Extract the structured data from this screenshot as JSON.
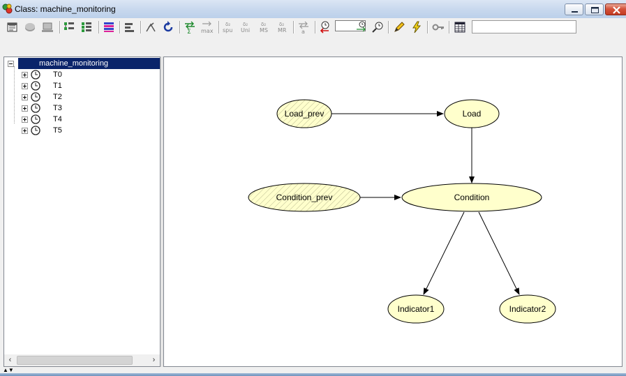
{
  "window": {
    "title": "Class: machine_monitoring"
  },
  "toolbar": {
    "search_value": "",
    "time_value": ""
  },
  "tree": {
    "root": "machine_monitoring",
    "children": [
      "T0",
      "T1",
      "T2",
      "T3",
      "T4",
      "T5"
    ]
  },
  "graph": {
    "nodes": {
      "load_prev": "Load_prev",
      "load": "Load",
      "condition_prev": "Condition_prev",
      "condition": "Condition",
      "indicator1": "Indicator1",
      "indicator2": "Indicator2"
    }
  },
  "colors": {
    "node_fill": "#ffffcc",
    "selection": "#0a246a",
    "title_gradient_top": "#dbe6f4",
    "close_red": "#c23a21"
  }
}
